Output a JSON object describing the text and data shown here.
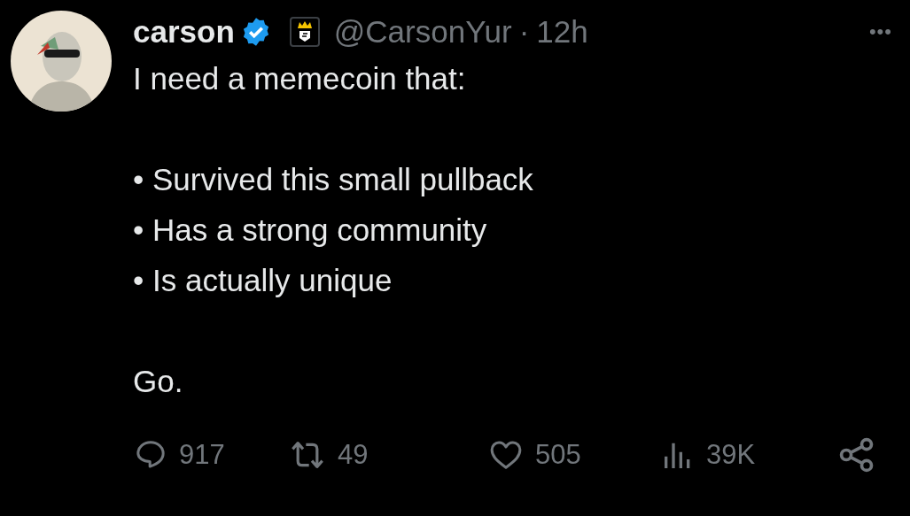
{
  "author": {
    "name": "carson",
    "verified": true,
    "handle": "@CarsonYur",
    "separator": "·",
    "time": "12h"
  },
  "more": "•••",
  "body": {
    "intro": "I need a memecoin that:",
    "bullets": [
      "• Survived this small pullback",
      "• Has a strong community",
      "• Is actually unique"
    ],
    "closing": "Go."
  },
  "actions": [
    {
      "kind": "reply",
      "count": "917"
    },
    {
      "kind": "repost",
      "count": "49"
    },
    {
      "kind": "like",
      "count": "505"
    },
    {
      "kind": "views",
      "count": "39K"
    }
  ]
}
